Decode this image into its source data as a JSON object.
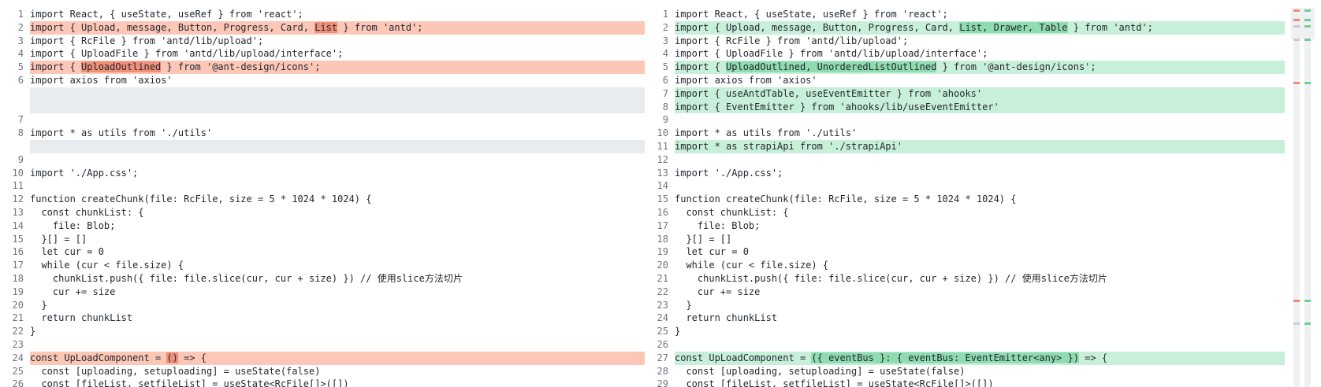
{
  "colors": {
    "deleted_line": "#fcc7b7",
    "deleted_word": "#f0907a",
    "inserted_line": "#c8efd9",
    "inserted_word": "#8fdcb0",
    "filler": "#e9ecef"
  },
  "left": [
    {
      "n": "1",
      "t": "normal",
      "segs": [
        {
          "text": "import React, { useState, useRef } from 'react';"
        }
      ]
    },
    {
      "n": "2",
      "t": "del",
      "segs": [
        {
          "text": "import { Upload, message, Button, Progress, Card, "
        },
        {
          "text": "List",
          "hl": true
        },
        {
          "text": " } from 'antd';"
        }
      ]
    },
    {
      "n": "3",
      "t": "normal",
      "segs": [
        {
          "text": "import { RcFile } from 'antd/lib/upload';"
        }
      ]
    },
    {
      "n": "4",
      "t": "normal",
      "segs": [
        {
          "text": "import { UploadFile } from 'antd/lib/upload/interface';"
        }
      ]
    },
    {
      "n": "5",
      "t": "del",
      "segs": [
        {
          "text": "import { "
        },
        {
          "text": "UploadOutlined",
          "hl": true
        },
        {
          "text": " } from '@ant-design/icons';"
        }
      ]
    },
    {
      "n": "6",
      "t": "normal",
      "segs": [
        {
          "text": "import axios from 'axios'"
        }
      ]
    },
    {
      "n": "",
      "t": "filler",
      "segs": []
    },
    {
      "n": "7",
      "t": "normal",
      "segs": [
        {
          "text": ""
        }
      ]
    },
    {
      "n": "8",
      "t": "normal",
      "segs": [
        {
          "text": "import * as utils from './utils'"
        }
      ]
    },
    {
      "n": "",
      "t": "filler1",
      "segs": []
    },
    {
      "n": "9",
      "t": "normal",
      "segs": [
        {
          "text": ""
        }
      ]
    },
    {
      "n": "10",
      "t": "normal",
      "segs": [
        {
          "text": "import './App.css';"
        }
      ]
    },
    {
      "n": "11",
      "t": "normal",
      "segs": [
        {
          "text": ""
        }
      ]
    },
    {
      "n": "12",
      "t": "normal",
      "segs": [
        {
          "text": "function createChunk(file: RcFile, size = 5 * 1024 * 1024) {"
        }
      ]
    },
    {
      "n": "13",
      "t": "normal",
      "segs": [
        {
          "text": "  const chunkList: {"
        }
      ]
    },
    {
      "n": "14",
      "t": "normal",
      "segs": [
        {
          "text": "    file: Blob;"
        }
      ]
    },
    {
      "n": "15",
      "t": "normal",
      "segs": [
        {
          "text": "  }[] = []"
        }
      ]
    },
    {
      "n": "16",
      "t": "normal",
      "segs": [
        {
          "text": "  let cur = 0"
        }
      ]
    },
    {
      "n": "17",
      "t": "normal",
      "segs": [
        {
          "text": "  while (cur < file.size) {"
        }
      ]
    },
    {
      "n": "18",
      "t": "normal",
      "segs": [
        {
          "text": "    chunkList.push({ file: file.slice(cur, cur + size) }) // 使用slice方法切片"
        }
      ]
    },
    {
      "n": "19",
      "t": "normal",
      "segs": [
        {
          "text": "    cur += size"
        }
      ]
    },
    {
      "n": "20",
      "t": "normal",
      "segs": [
        {
          "text": "  }"
        }
      ]
    },
    {
      "n": "21",
      "t": "normal",
      "segs": [
        {
          "text": "  return chunkList"
        }
      ]
    },
    {
      "n": "22",
      "t": "normal",
      "segs": [
        {
          "text": "}"
        }
      ]
    },
    {
      "n": "23",
      "t": "normal",
      "segs": [
        {
          "text": ""
        }
      ]
    },
    {
      "n": "24",
      "t": "del",
      "segs": [
        {
          "text": "const UpLoadComponent = "
        },
        {
          "text": "()",
          "hl": true
        },
        {
          "text": " => {"
        }
      ]
    },
    {
      "n": "25",
      "t": "normal",
      "segs": [
        {
          "text": "  const [uploading, setuploading] = useState(false)"
        }
      ]
    },
    {
      "n": "26",
      "t": "normal",
      "segs": [
        {
          "text": "  const [fileList, setfileList] = useState<RcFile[]>([])"
        }
      ]
    }
  ],
  "right": [
    {
      "n": "1",
      "t": "normal",
      "segs": [
        {
          "text": "import React, { useState, useRef } from 'react';"
        }
      ]
    },
    {
      "n": "2",
      "t": "ins",
      "segs": [
        {
          "text": "import { Upload, message, Button, Progress, Card, "
        },
        {
          "text": "List, Drawer, Table",
          "hl": true
        },
        {
          "text": " } from 'antd';"
        }
      ]
    },
    {
      "n": "3",
      "t": "normal",
      "segs": [
        {
          "text": "import { RcFile } from 'antd/lib/upload';"
        }
      ]
    },
    {
      "n": "4",
      "t": "normal",
      "segs": [
        {
          "text": "import { UploadFile } from 'antd/lib/upload/interface';"
        }
      ]
    },
    {
      "n": "5",
      "t": "ins",
      "segs": [
        {
          "text": "import { "
        },
        {
          "text": "UploadOutlined, UnorderedListOutlined",
          "hl": true
        },
        {
          "text": " } from '@ant-design/icons';"
        }
      ]
    },
    {
      "n": "6",
      "t": "normal",
      "segs": [
        {
          "text": "import axios from 'axios'"
        }
      ]
    },
    {
      "n": "7",
      "t": "ins",
      "segs": [
        {
          "text": "import { useAntdTable, useEventEmitter } from 'ahooks'"
        }
      ]
    },
    {
      "n": "8",
      "t": "ins",
      "segs": [
        {
          "text": "import { EventEmitter } from 'ahooks/lib/useEventEmitter'"
        }
      ]
    },
    {
      "n": "9",
      "t": "normal",
      "segs": [
        {
          "text": ""
        }
      ]
    },
    {
      "n": "10",
      "t": "normal",
      "segs": [
        {
          "text": "import * as utils from './utils'"
        }
      ]
    },
    {
      "n": "11",
      "t": "ins",
      "segs": [
        {
          "text": "import * as strapiApi from './strapiApi'"
        }
      ]
    },
    {
      "n": "12",
      "t": "normal",
      "segs": [
        {
          "text": ""
        }
      ]
    },
    {
      "n": "13",
      "t": "normal",
      "segs": [
        {
          "text": "import './App.css';"
        }
      ]
    },
    {
      "n": "14",
      "t": "normal",
      "segs": [
        {
          "text": ""
        }
      ]
    },
    {
      "n": "15",
      "t": "normal",
      "segs": [
        {
          "text": "function createChunk(file: RcFile, size = 5 * 1024 * 1024) {"
        }
      ]
    },
    {
      "n": "16",
      "t": "normal",
      "segs": [
        {
          "text": "  const chunkList: {"
        }
      ]
    },
    {
      "n": "17",
      "t": "normal",
      "segs": [
        {
          "text": "    file: Blob;"
        }
      ]
    },
    {
      "n": "18",
      "t": "normal",
      "segs": [
        {
          "text": "  }[] = []"
        }
      ]
    },
    {
      "n": "19",
      "t": "normal",
      "segs": [
        {
          "text": "  let cur = 0"
        }
      ]
    },
    {
      "n": "20",
      "t": "normal",
      "segs": [
        {
          "text": "  while (cur < file.size) {"
        }
      ]
    },
    {
      "n": "21",
      "t": "normal",
      "segs": [
        {
          "text": "    chunkList.push({ file: file.slice(cur, cur + size) }) // 使用slice方法切片"
        }
      ]
    },
    {
      "n": "22",
      "t": "normal",
      "segs": [
        {
          "text": "    cur += size"
        }
      ]
    },
    {
      "n": "23",
      "t": "normal",
      "segs": [
        {
          "text": "  }"
        }
      ]
    },
    {
      "n": "24",
      "t": "normal",
      "segs": [
        {
          "text": "  return chunkList"
        }
      ]
    },
    {
      "n": "25",
      "t": "normal",
      "segs": [
        {
          "text": "}"
        }
      ]
    },
    {
      "n": "26",
      "t": "normal",
      "segs": [
        {
          "text": ""
        }
      ]
    },
    {
      "n": "27",
      "t": "ins",
      "segs": [
        {
          "text": "const UpLoadComponent = "
        },
        {
          "text": "({ eventBus }: { eventBus: EventEmitter<any> })",
          "hl": true
        },
        {
          "text": " => {"
        }
      ]
    },
    {
      "n": "28",
      "t": "normal",
      "segs": [
        {
          "text": "  const [uploading, setuploading] = useState(false)"
        }
      ]
    },
    {
      "n": "29",
      "t": "normal",
      "segs": [
        {
          "text": "  const [fileList, setfileList] = useState<RcFile[]>([])"
        }
      ]
    }
  ],
  "overview": {
    "left_marks": [
      {
        "pos": 0.005,
        "kind": "del"
      },
      {
        "pos": 0.03,
        "kind": "del"
      },
      {
        "pos": 0.045,
        "kind": "gap"
      },
      {
        "pos": 0.08,
        "kind": "gap"
      },
      {
        "pos": 0.195,
        "kind": "del"
      },
      {
        "pos": 0.77,
        "kind": "del"
      },
      {
        "pos": 0.83,
        "kind": "gap"
      }
    ],
    "right_marks": [
      {
        "pos": 0.005,
        "kind": "ins"
      },
      {
        "pos": 0.03,
        "kind": "ins"
      },
      {
        "pos": 0.045,
        "kind": "ins"
      },
      {
        "pos": 0.08,
        "kind": "ins"
      },
      {
        "pos": 0.195,
        "kind": "ins"
      },
      {
        "pos": 0.77,
        "kind": "ins"
      },
      {
        "pos": 0.83,
        "kind": "ins"
      }
    ]
  }
}
